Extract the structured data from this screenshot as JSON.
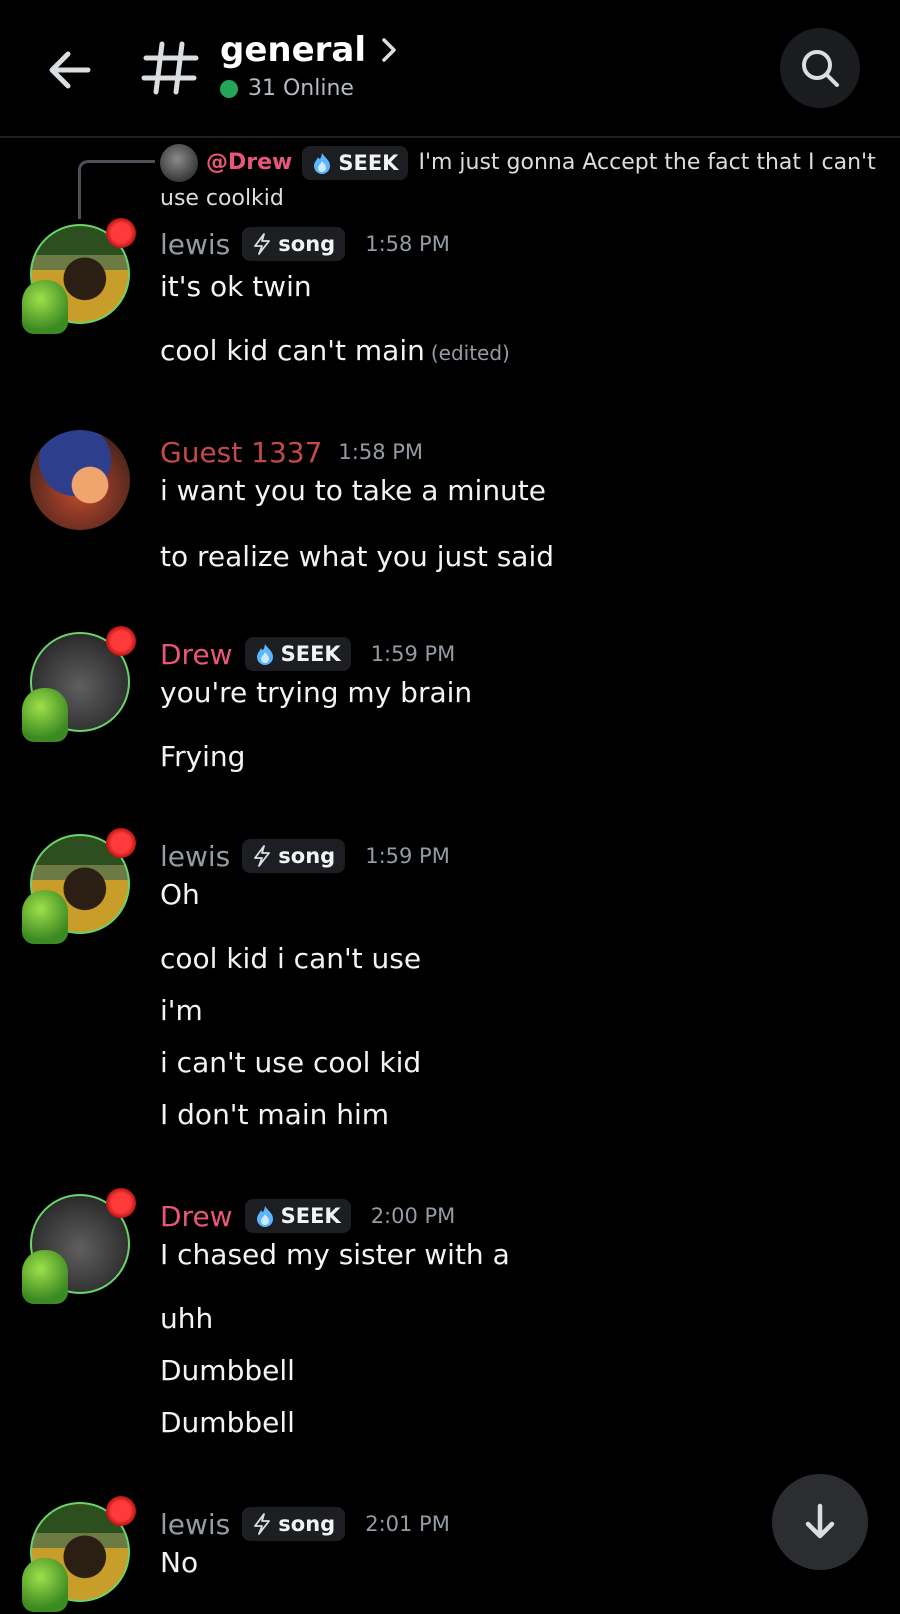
{
  "header": {
    "channel_name": "general",
    "online_text": "31 Online",
    "colors": {
      "online": "#23a55a"
    }
  },
  "reply": {
    "author": "@Drew",
    "tag": "SEEK",
    "text": "I'm just gonna Accept the fact that I can't use coolkid"
  },
  "messages": [
    {
      "author": "lewis",
      "author_color": "#949ba4",
      "tag": "song",
      "time": "1:58 PM",
      "lines": [
        "it's ok twin",
        "cool kid can't main"
      ],
      "edited": "(edited)"
    },
    {
      "author": "Guest 1337",
      "author_color": "#c24a4a",
      "time": "1:58 PM",
      "lines": [
        "i want you to take a minute",
        "to realize what you just said"
      ]
    },
    {
      "author": "Drew",
      "author_color": "#e8567a",
      "tag": "SEEK",
      "time": "1:59 PM",
      "lines": [
        "you're trying my brain",
        "Frying"
      ]
    },
    {
      "author": "lewis",
      "author_color": "#949ba4",
      "tag": "song",
      "time": "1:59 PM",
      "lines": [
        "Oh",
        "cool kid i can't use",
        "i'm",
        "i can't use cool kid",
        "I don't main him"
      ]
    },
    {
      "author": "Drew",
      "author_color": "#e8567a",
      "tag": "SEEK",
      "time": "2:00 PM",
      "lines": [
        "I chased my sister with a",
        "uhh",
        "Dumbbell",
        "Dumbbell"
      ]
    },
    {
      "author": "lewis",
      "author_color": "#949ba4",
      "tag": "song",
      "time": "2:01 PM",
      "lines": [
        "No"
      ]
    }
  ]
}
